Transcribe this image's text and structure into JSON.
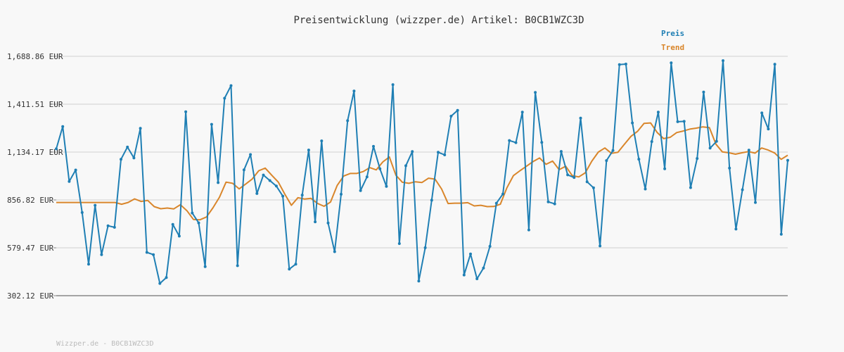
{
  "chart_data": {
    "type": "line",
    "title": "Preisentwicklung (wizzper.de) Artikel: B0CB1WZC3D",
    "footer": "Wizzper.de - B0CB1WZC3D",
    "y_tick_labels": [
      "1,688.86 EUR",
      "1,411.51 EUR",
      "1,134.17 EUR",
      "856.82 EUR",
      "579.47 EUR",
      "302.12 EUR"
    ],
    "y_ticks": [
      1688.86,
      1411.51,
      1134.17,
      856.82,
      579.47,
      302.12
    ],
    "ylim": [
      302.12,
      1688.86
    ],
    "grid": true,
    "legend_position": "top-right",
    "colors": {
      "preis": "#1f7fb4",
      "trend": "#d9862b",
      "grid": "#dddddd",
      "axis": "#888888"
    },
    "series": [
      {
        "name": "Preis",
        "values": [
          1153,
          1282,
          964,
          1030,
          784,
          485,
          826,
          540,
          707,
          698,
          1092,
          1163,
          1100,
          1272,
          553,
          540,
          373,
          407,
          715,
          647,
          1368,
          781,
          724,
          470,
          1295,
          957,
          1446,
          1519,
          476,
          1031,
          1120,
          894,
          1001,
          969,
          937,
          879,
          456,
          485,
          885,
          1146,
          730,
          1199,
          723,
          557,
          890,
          1316,
          1488,
          911,
          990,
          1167,
          1037,
          935,
          1525,
          604,
          1055,
          1137,
          387,
          580,
          855,
          1133,
          1118,
          1342,
          1376,
          422,
          544,
          400,
          462,
          588,
          838,
          891,
          1201,
          1189,
          1366,
          683,
          1480,
          1190,
          846,
          834,
          1138,
          1002,
          987,
          1331,
          962,
          927,
          590,
          1085,
          1143,
          1641,
          1644,
          1303,
          1093,
          920,
          1195,
          1366,
          1037,
          1651,
          1310,
          1312,
          928,
          1097,
          1482,
          1157,
          1196,
          1664,
          1041,
          688,
          916,
          1145,
          842,
          1361,
          1268,
          1643,
          658,
          1086
        ],
        "labels_printed": true
      },
      {
        "name": "Trend",
        "values": [
          842,
          842,
          842,
          842,
          842,
          842,
          842,
          842,
          842,
          842,
          832,
          842,
          863,
          848,
          854,
          818,
          806,
          810,
          805,
          829,
          795,
          744,
          742,
          758,
          812,
          873,
          960,
          953,
          921,
          949,
          978,
          1026,
          1041,
          1000,
          960,
          890,
          826,
          870,
          862,
          866,
          837,
          820,
          845,
          940,
          995,
          1010,
          1010,
          1021,
          1044,
          1031,
          1077,
          1106,
          1000,
          959,
          953,
          962,
          958,
          983,
          977,
          920,
          836,
          838,
          838,
          841,
          822,
          826,
          818,
          819,
          832,
          927,
          998,
          1026,
          1052,
          1079,
          1100,
          1063,
          1082,
          1032,
          1052,
          998,
          990,
          1014,
          1081,
          1134,
          1158,
          1127,
          1133,
          1180,
          1225,
          1254,
          1300,
          1303,
          1248,
          1212,
          1220,
          1247,
          1256,
          1267,
          1273,
          1280,
          1276,
          1180,
          1135,
          1130,
          1122,
          1130,
          1137,
          1128,
          1158,
          1146,
          1129,
          1092,
          1116
        ]
      }
    ]
  }
}
